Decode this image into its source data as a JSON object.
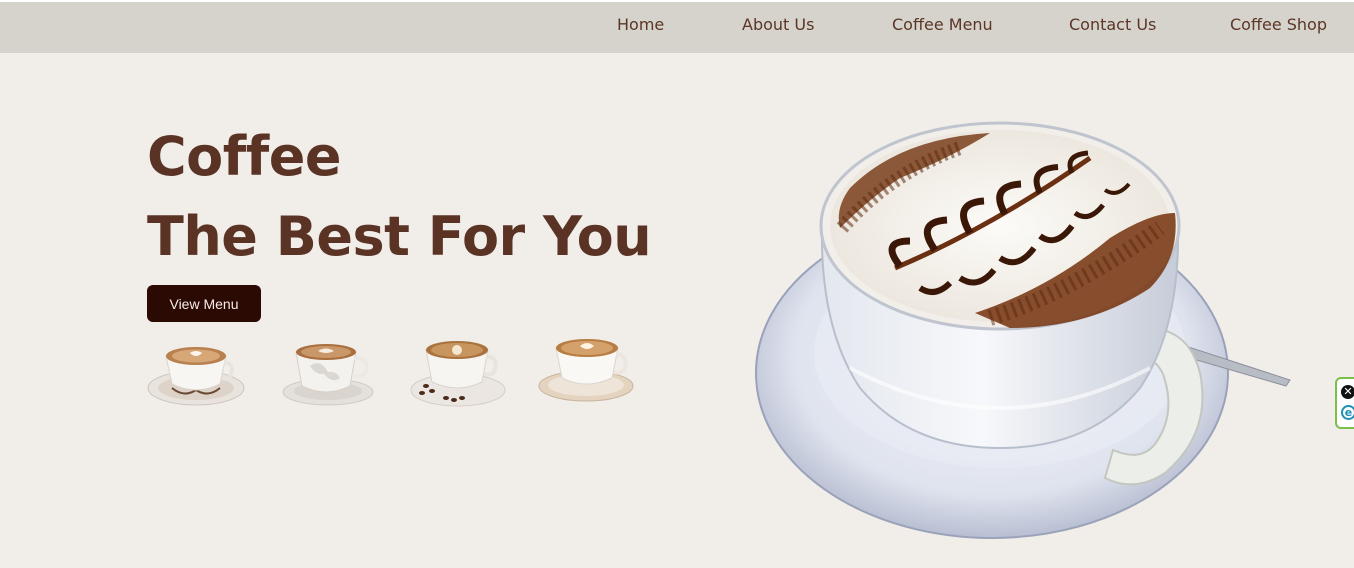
{
  "nav": {
    "items": [
      {
        "label": "Home"
      },
      {
        "label": "About Us"
      },
      {
        "label": "Coffee Menu"
      },
      {
        "label": "Contact Us"
      },
      {
        "label": "Coffee Shop"
      }
    ]
  },
  "hero": {
    "title_line1": "Coffee",
    "title_line2": "The Best For You",
    "button_label": "View Menu"
  },
  "widget": {
    "close_glyph": "✕",
    "e_glyph": "e"
  },
  "colors": {
    "navbar_bg": "#d6d3cc",
    "page_bg": "#f1eeea",
    "title_brown": "#5a3325",
    "button_bg": "#2c0a04"
  }
}
